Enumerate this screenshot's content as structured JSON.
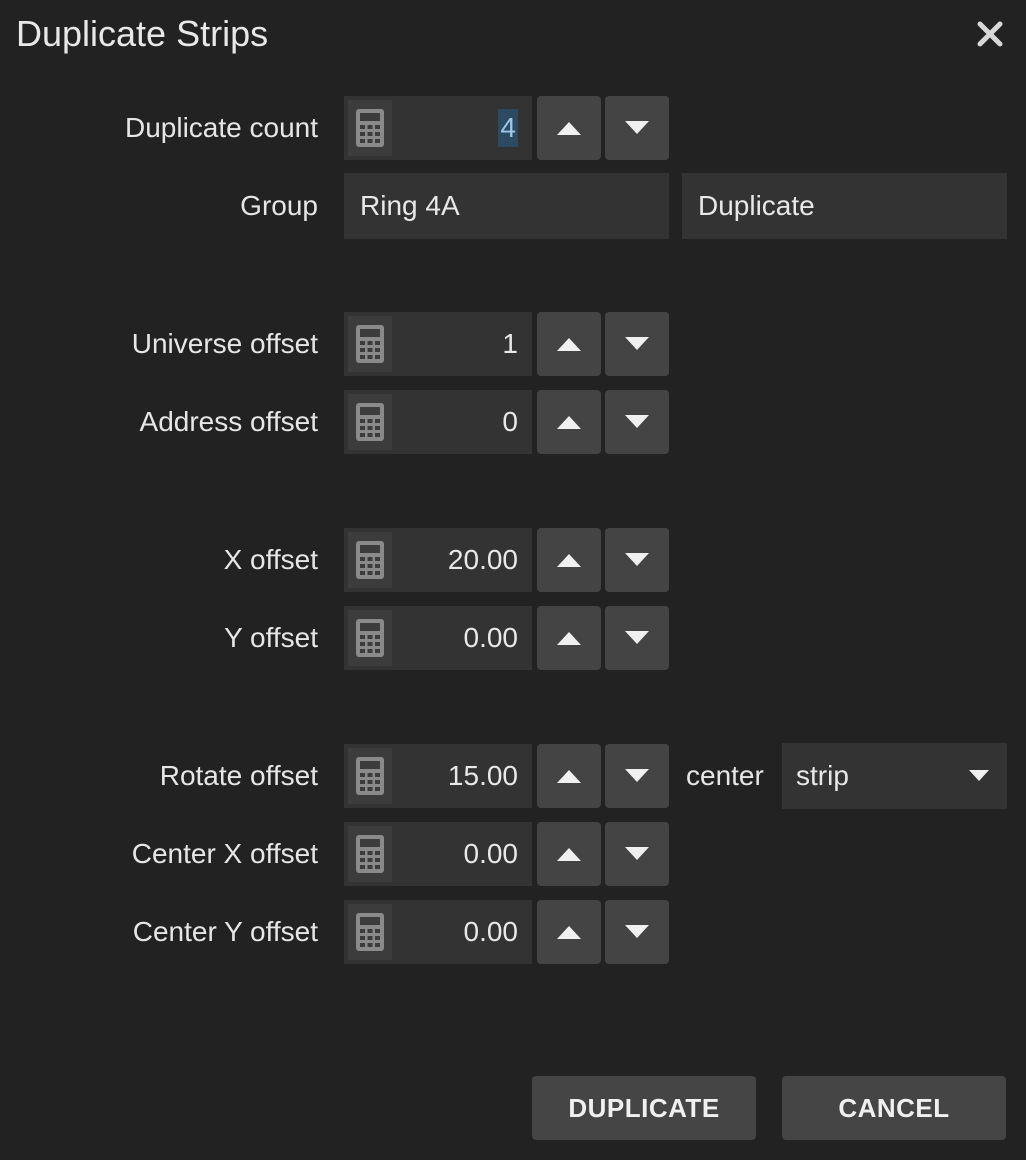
{
  "dialog": {
    "title": "Duplicate Strips",
    "close_icon": "close-icon"
  },
  "fields": {
    "duplicate_count": {
      "label": "Duplicate count",
      "value": "4"
    },
    "group": {
      "label": "Group",
      "value": "Ring 4A",
      "suffix_value": "Duplicate"
    },
    "universe_offset": {
      "label": "Universe offset",
      "value": "1"
    },
    "address_offset": {
      "label": "Address offset",
      "value": "0"
    },
    "x_offset": {
      "label": "X offset",
      "value": "20.00"
    },
    "y_offset": {
      "label": "Y offset",
      "value": "0.00"
    },
    "rotate_offset": {
      "label": "Rotate offset",
      "value": "15.00"
    },
    "rotate_center": {
      "label": "center",
      "selected": "strip"
    },
    "center_x_offset": {
      "label": "Center X offset",
      "value": "0.00"
    },
    "center_y_offset": {
      "label": "Center Y offset",
      "value": "0.00"
    }
  },
  "icons": {
    "calculator": "calculator-icon",
    "up": "arrow-up-icon",
    "down": "arrow-down-icon",
    "dropdown": "chevron-down-icon"
  },
  "buttons": {
    "duplicate": "DUPLICATE",
    "cancel": "CANCEL"
  }
}
